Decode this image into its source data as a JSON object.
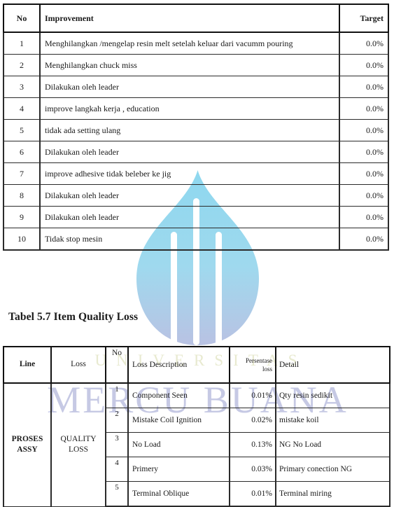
{
  "watermark": {
    "university_text": "UNIVERSITAS",
    "brand_text": "MERCU BUANA",
    "logo_name": "mercu-buana-flame-logo",
    "colors": {
      "logo_top": "#8ed8ef",
      "logo_bottom": "#b9c2e3",
      "university_text": "#e8ead0",
      "brand_text": "#c6c9e4"
    }
  },
  "table_improvement": {
    "headers": {
      "no": "No",
      "improvement": "Improvement",
      "target": "Target"
    },
    "rows": [
      {
        "no": "1",
        "improvement": "Menghilangkan /mengelap resin melt setelah keluar dari vacumm pouring",
        "target": "0.0%"
      },
      {
        "no": "2",
        "improvement": "Menghilangkan chuck miss",
        "target": "0.0%"
      },
      {
        "no": "3",
        "improvement": "Dilakukan oleh leader",
        "target": "0.0%"
      },
      {
        "no": "4",
        "improvement": "improve langkah kerja , education",
        "target": "0.0%"
      },
      {
        "no": "5",
        "improvement": "tidak ada setting ulang",
        "target": "0.0%"
      },
      {
        "no": "6",
        "improvement": "Dilakukan oleh leader",
        "target": "0.0%"
      },
      {
        "no": "7",
        "improvement": "improve adhesive tidak beleber ke jig",
        "target": "0.0%"
      },
      {
        "no": "8",
        "improvement": "Dilakukan oleh leader",
        "target": "0.0%"
      },
      {
        "no": "9",
        "improvement": "Dilakukan oleh leader",
        "target": "0.0%"
      },
      {
        "no": "10",
        "improvement": "Tidak stop mesin",
        "target": "0.0%"
      }
    ]
  },
  "caption_57": "Tabel 5.7 Item Quality Loss",
  "table_quality_loss": {
    "headers": {
      "line": "Line",
      "loss": "Loss",
      "no": "No",
      "loss_description": "Loss Description",
      "persentase_loss_line1": "Persentase",
      "persentase_loss_line2": "loss",
      "detail": "Detail"
    },
    "line_label_line1": "PROSES",
    "line_label_line2": "ASSY",
    "loss_label_line1": "QUALITY",
    "loss_label_line2": "LOSS",
    "rows": [
      {
        "no": "1",
        "description": "Component Seen",
        "percent": "0.01%",
        "detail": "Qty resin sedikit"
      },
      {
        "no": "2",
        "description": "Mistake Coil Ignition",
        "percent": "0.02%",
        "detail": "mistake koil"
      },
      {
        "no": "3",
        "description": "No Load",
        "percent": "0.13%",
        "detail": "NG No Load"
      },
      {
        "no": "4",
        "description": "Primery",
        "percent": "0.03%",
        "detail": "Primary conection NG"
      },
      {
        "no": "5",
        "description": "Terminal Oblique",
        "percent": "0.01%",
        "detail": "Terminal miring"
      }
    ]
  }
}
